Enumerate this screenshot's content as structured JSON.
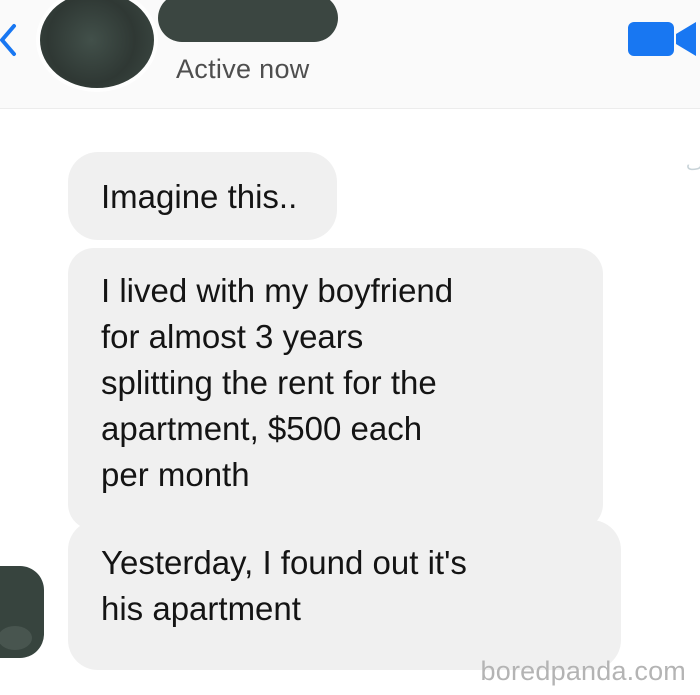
{
  "header": {
    "status": "Active now",
    "icons": {
      "back": "chevron-left-icon",
      "video": "video-camera-icon"
    },
    "colors": {
      "accent": "#1877f2",
      "redaction": "#36423d"
    }
  },
  "messages": [
    {
      "text": "Imagine this.."
    },
    {
      "text": "I lived with my boyfriend\nfor almost 3 years\nsplitting the rent for the\napartment, $500 each\nper month"
    },
    {
      "text": "Yesterday, I found out it's\nhis apartment"
    }
  ],
  "watermark": "boredpanda.com"
}
